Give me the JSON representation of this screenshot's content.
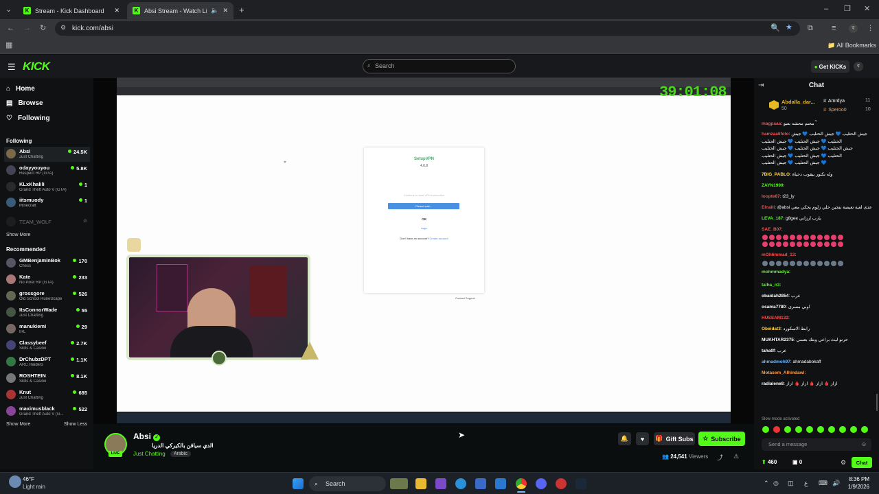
{
  "browser": {
    "tabs": [
      {
        "title": "Stream - Kick Dashboard"
      },
      {
        "title": "Absi Stream - Watch Live on Kick"
      }
    ],
    "url": "kick.com/absi",
    "bookmarks_label": "All Bookmarks"
  },
  "header": {
    "logo": "KICK",
    "search_placeholder": "Search",
    "get_kicks": "Get KICKs",
    "avatar_letter": "ব"
  },
  "sidebar": {
    "nav": [
      "Home",
      "Browse",
      "Following"
    ],
    "following_title": "Following",
    "following": [
      {
        "name": "Absi",
        "category": "Just Chatting",
        "viewers": "24.5K"
      },
      {
        "name": "odayyouyou",
        "category": "Respect RP (GTA)",
        "viewers": "5.8K"
      },
      {
        "name": "KLxKhalili",
        "category": "Grand Theft Auto V (GTA)",
        "viewers": "1"
      },
      {
        "name": "iitsmuody",
        "category": "Minecraft",
        "viewers": "1"
      },
      {
        "name": "TEAM_WOLF",
        "category": "",
        "viewers": ""
      }
    ],
    "show_more": "Show More",
    "recommended_title": "Recommended",
    "recommended": [
      {
        "name": "GMBenjaminBok",
        "category": "Chess",
        "viewers": "170"
      },
      {
        "name": "Kate",
        "category": "No Pixel RP (GTA)",
        "viewers": "233"
      },
      {
        "name": "grossgore",
        "category": "Old School RuneScape",
        "viewers": "526"
      },
      {
        "name": "ItsConnorWade",
        "category": "Just Chatting",
        "viewers": "55"
      },
      {
        "name": "manukiemi",
        "category": "IRL",
        "viewers": "29"
      },
      {
        "name": "Classybeef",
        "category": "Slots & Casino",
        "viewers": "2.7K"
      },
      {
        "name": "DrChubzDPT",
        "category": "ARC Raiders",
        "viewers": "1.1K"
      },
      {
        "name": "ROSHTEIN",
        "category": "Slots & Casino",
        "viewers": "8.1K"
      },
      {
        "name": "Knut",
        "category": "Just Chatting",
        "viewers": "685"
      },
      {
        "name": "maximusblack",
        "category": "Grand Theft Auto V (G...",
        "viewers": "522"
      }
    ],
    "show_more_2": "Show More",
    "show_less": "Show Less"
  },
  "player": {
    "timer": "39:01:08",
    "vpn_brand": "SetupVPN",
    "vpn_version": "4.6.8",
    "vpn_text": "Continue to start VPN connection",
    "vpn_button": "Please wait...",
    "vpn_or": "OR",
    "vpn_login": "Login",
    "vpn_noaccount": "Don't have an account?",
    "vpn_create": "Create account",
    "vpn_support": "Contact Support"
  },
  "stream": {
    "live_badge": "LIVE",
    "streamer": "Absi",
    "title": "الدي سياقن بالكيركي الدريا",
    "category": "Just Chatting",
    "tag": "Arabic",
    "gift_subs": "Gift Subs",
    "subscribe": "Subscribe",
    "viewers": "24,541",
    "viewers_label": "Viewers"
  },
  "chat": {
    "title": "Chat",
    "top_gifters": [
      {
        "name": "Abdalla_dar...",
        "count": "50"
      },
      {
        "name": "Amrdya",
        "count": "11"
      },
      {
        "name": "Speroo0",
        "count": "10"
      }
    ],
    "messages": [
      {
        "user": "magpaaa",
        "color": "#ff4d4d",
        "text": "محتم محشه بعبو"
      },
      {
        "user": "hamzaalifoto",
        "color": "#ff4d4d",
        "text": "جيش الحتليب 💙 جيش الحتليب 💙 جيش"
      },
      {
        "user": "",
        "color": "#fff",
        "text": "الحتليب 💙 جيش الحتليب 💙 جيش الحتليب"
      },
      {
        "user": "",
        "color": "#fff",
        "text": "جيش الحتليب 💙 جيش الحتليب 💙 جيش الحتليب"
      },
      {
        "user": "",
        "color": "#fff",
        "text": "الحتليب 💙 جيش الحتليب 💙 جيش الحتليب"
      },
      {
        "user": "",
        "color": "#fff",
        "text": "جيش الحتليب 💙 جيش الحتليب 💙"
      },
      {
        "user": "7BIG_PABLO",
        "color": "#ffd84d",
        "text": "وله نكتور بيقوب دحياة"
      },
      {
        "user": "ZAYN1999",
        "color": "#53fc18",
        "text": ""
      },
      {
        "user": "loopte87",
        "color": "#ff4d4d",
        "text": "t23_ly"
      },
      {
        "user": "Elnaili",
        "color": "#ff4d4d",
        "text": "@absi عدى لعبة تعيصة بتجين حلي زلوم يحكي معي"
      },
      {
        "user": "LEVA_187",
        "color": "#53fc18",
        "text": "g8gee بارب ارزاني"
      },
      {
        "user": "SAE_B07",
        "color": "#ff4d4d",
        "text": ""
      },
      {
        "user": "mOh6mmad_13",
        "color": "#ff4d4d",
        "text": ""
      },
      {
        "user": "mohmmadya",
        "color": "#53fc18",
        "text": ""
      },
      {
        "user": "talha_n3",
        "color": "#53fc18",
        "text": ""
      },
      {
        "user": "obaidah2854",
        "color": "#fff",
        "text": "عرب"
      },
      {
        "user": "osama7780",
        "color": "#fff",
        "text": "اوبي مسرى"
      },
      {
        "user": "HUSSAM132",
        "color": "#ff4d4d",
        "text": ""
      },
      {
        "user": "Obeidat3",
        "color": "#ffd84d",
        "text": "رابط الاسكورد"
      },
      {
        "user": "MUKHTAR2375",
        "color": "#fff",
        "text": "حرنو ليث براعي وبتك بعسي"
      },
      {
        "user": "taha0f",
        "color": "#fff",
        "text": "عرب"
      },
      {
        "user": "ahmadmoh97",
        "color": "#6fb7ff",
        "text": "ahmadabokaff"
      },
      {
        "user": "Motasem_Alhindawi",
        "color": "#ff9f4d",
        "text": ""
      },
      {
        "user": "radialene8",
        "color": "#fff",
        "text": "ازاز 🩸 ازاز 🩸 ازاز 🩸 ازاز"
      }
    ],
    "slow_mode": "Slow mode activated",
    "message_placeholder": "Send a message",
    "points": "460",
    "zero": "0",
    "chat_button": "Chat"
  },
  "taskbar": {
    "weather_temp": "46°F",
    "weather_desc": "Light rain",
    "search": "Search",
    "time": "8:36 PM",
    "date": "1/9/2026"
  }
}
